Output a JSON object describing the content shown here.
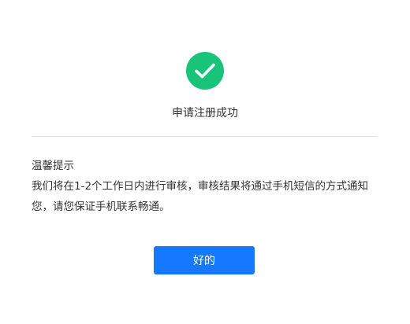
{
  "dialog": {
    "icon": "check-circle-icon",
    "success_color": "#19c47a",
    "title": "申请注册成功",
    "tip_heading": "温馨提示",
    "tip_body": "我们将在1-2个工作日内进行审核，审核结果将通过手机短信的方式通知您，请您保证手机联系畅通。",
    "ok_label": "好的",
    "button_color": "#1677ff"
  }
}
